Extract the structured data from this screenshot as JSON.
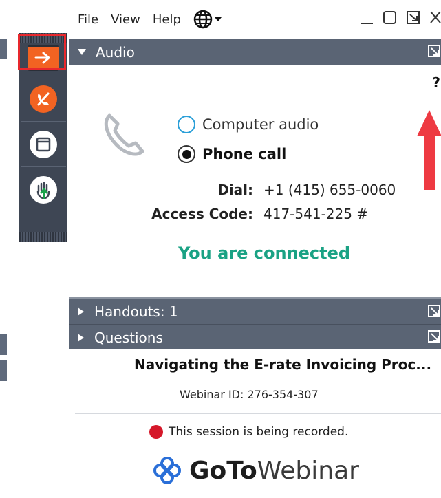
{
  "menu": {
    "file": "File",
    "view": "View",
    "help": "Help"
  },
  "toolbar": {
    "items": [
      {
        "icon": "arrow-right-icon",
        "color": "#f26322"
      },
      {
        "icon": "mute-phone-icon",
        "color": "#f26322"
      },
      {
        "icon": "screen-icon",
        "color": "#ffffff"
      },
      {
        "icon": "raise-hand-icon",
        "color": "#ffffff"
      }
    ]
  },
  "audio": {
    "header": "Audio",
    "help_glyph": "?",
    "options": [
      {
        "label": "Computer audio",
        "selected": false
      },
      {
        "label": "Phone call",
        "selected": true
      }
    ],
    "dial_label": "Dial:",
    "dial_value": "+1 (415) 655-0060",
    "access_label": "Access Code:",
    "access_value": "417-541-225 #",
    "status": "You are connected"
  },
  "handouts": {
    "header": "Handouts: 1"
  },
  "questions": {
    "header": "Questions"
  },
  "webinar": {
    "title": "Navigating the E-rate Invoicing Proc...",
    "id_text": "Webinar ID: 276-354-307",
    "recording_text": "This session is being recorded.",
    "logo_bold": "GoTo",
    "logo_light": "Webinar"
  },
  "colors": {
    "accent_orange": "#f26322",
    "connected_green": "#1aa284",
    "header_gray": "#5a6474",
    "highlight_red": "#e8282d",
    "radio_blue": "#2a9fd8",
    "logo_blue": "#2a6fd8"
  }
}
